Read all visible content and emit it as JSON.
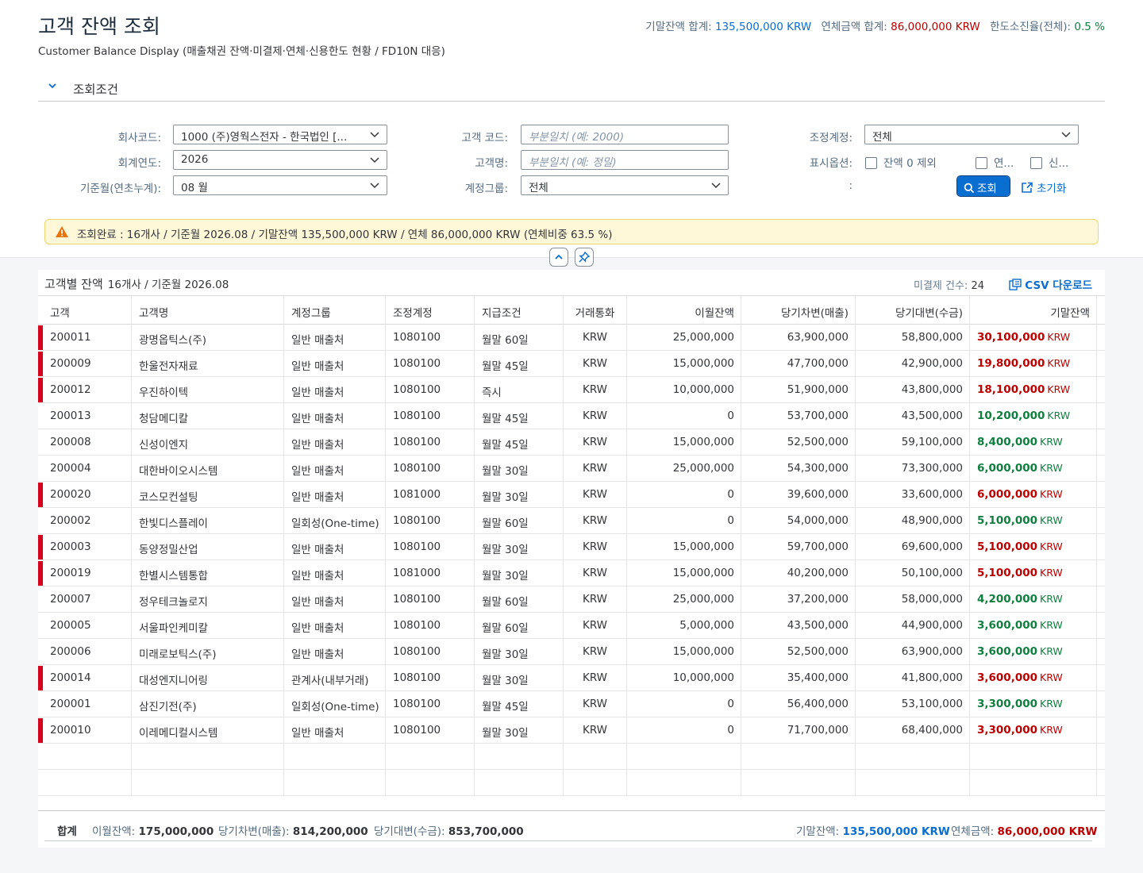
{
  "header": {
    "title": "고객 잔액 조회",
    "subtitle": "Customer Balance Display (매출채권 잔액·미결제·연체·신용한도 현황 / FD10N 대응)",
    "kpis": [
      {
        "label": "기말잔액 합계:",
        "value": "135,500,000 KRW",
        "color": "#0a6ed1"
      },
      {
        "label": "연체금액 합계:",
        "value": "86,000,000 KRW",
        "color": "#bb0000"
      },
      {
        "label": "한도소진율(전체):",
        "value": "0.5 %",
        "color": "#107e3e"
      }
    ]
  },
  "filter": {
    "section_title": "조회조건",
    "company_label": "회사코드:",
    "company_value": "1000 (주)영웍스전자 - 한국법인 [...",
    "year_label": "회계연도:",
    "year_value": "2026",
    "period_label": "기준월(연초누계):",
    "period_value": "08 월",
    "customer_code_label": "고객 코드:",
    "customer_code_placeholder": "부분일치 (예: 2000)",
    "customer_name_label": "고객명:",
    "customer_name_placeholder": "부분일치 (예: 정밀)",
    "account_group_label": "계정그룹:",
    "account_group_value": "전체",
    "recon_label": "조정계정:",
    "recon_value": "전체",
    "display_label": "표시옵션:",
    "opt1": "잔액 0 제외",
    "opt2": "연...",
    "opt3": "신...",
    "colon3": ":",
    "search_button": "조회",
    "reset_button": "초기화"
  },
  "message": "조회완료 : 16개사 / 기준월 2026.08 / 기말잔액 135,500,000 KRW / 연체 86,000,000 KRW (연체비중 63.5 %)",
  "table": {
    "title": "고객별 잔액",
    "subtitle": "16개사 / 기준월 2026.08",
    "unpaid_label": "미결제 건수:",
    "unpaid_count": "24",
    "csv_label": "CSV 다운로드",
    "columns": [
      "고객",
      "고객명",
      "계정그룹",
      "조정계정",
      "지급조건",
      "거래통화",
      "이월잔액",
      "당기차변(매출)",
      "당기대변(수금)",
      "기말잔액"
    ],
    "rows": [
      {
        "id": "200011",
        "name": "광명옵틱스(주)",
        "group": "일반 매출처",
        "recon": "1080100",
        "terms": "월말 60일",
        "cur": "KRW",
        "carry": "25,000,000",
        "debit": "63,900,000",
        "credit": "58,800,000",
        "end": "30,100,000",
        "overdue": true
      },
      {
        "id": "200009",
        "name": "한울전자재료",
        "group": "일반 매출처",
        "recon": "1080100",
        "terms": "월말 45일",
        "cur": "KRW",
        "carry": "15,000,000",
        "debit": "47,700,000",
        "credit": "42,900,000",
        "end": "19,800,000",
        "overdue": true
      },
      {
        "id": "200012",
        "name": "우진하이텍",
        "group": "일반 매출처",
        "recon": "1080100",
        "terms": "즉시",
        "cur": "KRW",
        "carry": "10,000,000",
        "debit": "51,900,000",
        "credit": "43,800,000",
        "end": "18,100,000",
        "overdue": true
      },
      {
        "id": "200013",
        "name": "청담메디칼",
        "group": "일반 매출처",
        "recon": "1080100",
        "terms": "월말 45일",
        "cur": "KRW",
        "carry": "0",
        "debit": "53,700,000",
        "credit": "43,500,000",
        "end": "10,200,000",
        "overdue": false
      },
      {
        "id": "200008",
        "name": "신성이엔지",
        "group": "일반 매출처",
        "recon": "1080100",
        "terms": "월말 45일",
        "cur": "KRW",
        "carry": "15,000,000",
        "debit": "52,500,000",
        "credit": "59,100,000",
        "end": "8,400,000",
        "overdue": false
      },
      {
        "id": "200004",
        "name": "대한바이오시스템",
        "group": "일반 매출처",
        "recon": "1080100",
        "terms": "월말 30일",
        "cur": "KRW",
        "carry": "25,000,000",
        "debit": "54,300,000",
        "credit": "73,300,000",
        "end": "6,000,000",
        "overdue": false
      },
      {
        "id": "200020",
        "name": "코스모컨설팅",
        "group": "일반 매출처",
        "recon": "1081000",
        "terms": "월말 30일",
        "cur": "KRW",
        "carry": "0",
        "debit": "39,600,000",
        "credit": "33,600,000",
        "end": "6,000,000",
        "overdue": true
      },
      {
        "id": "200002",
        "name": "한빛디스플레이",
        "group": "일회성(One-time)",
        "recon": "1080100",
        "terms": "월말 60일",
        "cur": "KRW",
        "carry": "0",
        "debit": "54,000,000",
        "credit": "48,900,000",
        "end": "5,100,000",
        "overdue": false
      },
      {
        "id": "200003",
        "name": "동양정밀산업",
        "group": "일반 매출처",
        "recon": "1080100",
        "terms": "월말 30일",
        "cur": "KRW",
        "carry": "15,000,000",
        "debit": "59,700,000",
        "credit": "69,600,000",
        "end": "5,100,000",
        "overdue": true
      },
      {
        "id": "200019",
        "name": "한별시스템통합",
        "group": "일반 매출처",
        "recon": "1081000",
        "terms": "월말 30일",
        "cur": "KRW",
        "carry": "15,000,000",
        "debit": "40,200,000",
        "credit": "50,100,000",
        "end": "5,100,000",
        "overdue": true
      },
      {
        "id": "200007",
        "name": "정우테크놀로지",
        "group": "일반 매출처",
        "recon": "1080100",
        "terms": "월말 60일",
        "cur": "KRW",
        "carry": "25,000,000",
        "debit": "37,200,000",
        "credit": "58,000,000",
        "end": "4,200,000",
        "overdue": false
      },
      {
        "id": "200005",
        "name": "서울파인케미칼",
        "group": "일반 매출처",
        "recon": "1080100",
        "terms": "월말 60일",
        "cur": "KRW",
        "carry": "5,000,000",
        "debit": "43,500,000",
        "credit": "44,900,000",
        "end": "3,600,000",
        "overdue": false
      },
      {
        "id": "200006",
        "name": "미래로보틱스(주)",
        "group": "일반 매출처",
        "recon": "1080100",
        "terms": "월말 30일",
        "cur": "KRW",
        "carry": "15,000,000",
        "debit": "52,500,000",
        "credit": "63,900,000",
        "end": "3,600,000",
        "overdue": false
      },
      {
        "id": "200014",
        "name": "대성엔지니어링",
        "group": "관계사(내부거래)",
        "recon": "1080100",
        "terms": "월말 30일",
        "cur": "KRW",
        "carry": "10,000,000",
        "debit": "35,400,000",
        "credit": "41,800,000",
        "end": "3,600,000",
        "overdue": true
      },
      {
        "id": "200001",
        "name": "삼진기전(주)",
        "group": "일회성(One-time)",
        "recon": "1080100",
        "terms": "월말 45일",
        "cur": "KRW",
        "carry": "0",
        "debit": "56,400,000",
        "credit": "53,100,000",
        "end": "3,300,000",
        "overdue": false
      },
      {
        "id": "200010",
        "name": "이레메디컬시스템",
        "group": "일반 매출처",
        "recon": "1080100",
        "terms": "월말 30일",
        "cur": "KRW",
        "carry": "0",
        "debit": "71,700,000",
        "credit": "68,400,000",
        "end": "3,300,000",
        "overdue": true
      }
    ],
    "currency_suffix": "KRW"
  },
  "footer": {
    "label": "합계",
    "carry_label": "이월잔액:",
    "carry_value": "175,000,000",
    "debit_label": "당기차변(매출):",
    "debit_value": "814,200,000",
    "credit_label": "당기대변(수금):",
    "credit_value": "853,700,000",
    "end_label": "기말잔액:",
    "end_value": "135,500,000 KRW",
    "overdue_label": "연체금액:",
    "overdue_value": "86,000,000 KRW"
  },
  "colors": {
    "overdue": "#bb0000",
    "normal": "#107e3e",
    "accent": "#0a6ed1",
    "flag": "#d5001b"
  }
}
